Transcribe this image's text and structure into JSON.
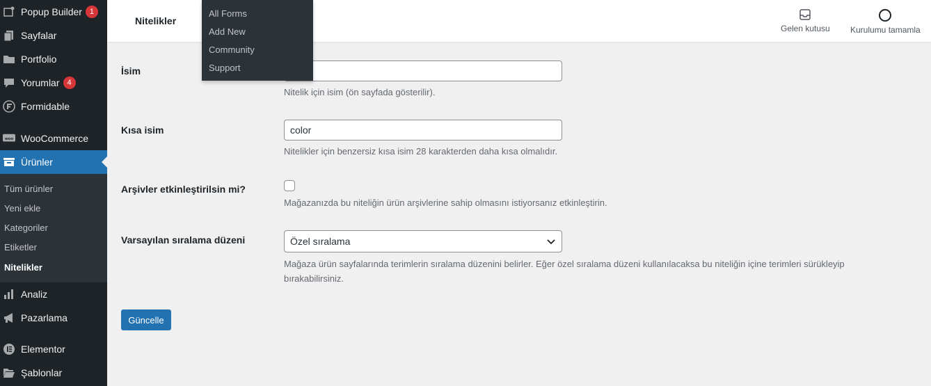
{
  "sidebar": {
    "items": [
      {
        "label": "Popup Builder",
        "badge": "1",
        "icon": "popup-icon"
      },
      {
        "label": "Sayfalar",
        "icon": "pages-icon"
      },
      {
        "label": "Portfolio",
        "icon": "folder-icon"
      },
      {
        "label": "Yorumlar",
        "badge": "4",
        "icon": "comment-icon"
      },
      {
        "label": "Formidable",
        "icon": "formidable-icon"
      },
      {
        "label": "WooCommerce",
        "icon": "woo-icon"
      },
      {
        "label": "Ürünler",
        "icon": "archive-icon"
      },
      {
        "label": "Analiz",
        "icon": "chart-icon"
      },
      {
        "label": "Pazarlama",
        "icon": "megaphone-icon"
      },
      {
        "label": "Elementor",
        "icon": "elementor-icon"
      },
      {
        "label": "Şablonlar",
        "icon": "folder-open-icon"
      }
    ],
    "submenu": [
      "Tüm ürünler",
      "Yeni ekle",
      "Kategoriler",
      "Etiketler",
      "Nitelikler"
    ]
  },
  "header": {
    "title": "Nitelikler",
    "inbox_label": "Gelen kutusu",
    "setup_label": "Kurulumu tamamla"
  },
  "flyout": [
    "All Forms",
    "Add New",
    "Community",
    "Support"
  ],
  "form": {
    "name_label": "İsim",
    "name_value": "",
    "name_desc": "Nitelik için isim (ön sayfada gösterilir).",
    "slug_label": "Kısa isim",
    "slug_value": "color",
    "slug_desc": "Nitelikler için benzersiz kısa isim 28 karakterden daha kısa olmalıdır.",
    "archive_label": "Arşivler etkinleştirilsin mi?",
    "archive_desc": "Mağazanızda bu niteliğin ürün arşivlerine sahip olmasını istiyorsanız etkinleştirin.",
    "order_label": "Varsayılan sıralama düzeni",
    "order_value": "Özel sıralama",
    "order_desc_1": "Mağaza ürün sayfalarında terimlerin sıralama düzenini belirler. Eğer özel sıralama düzeni kullanılacaksa bu niteliğin içine terimleri sürükleyip",
    "order_desc_2": "bırakabilirsiniz.",
    "submit_label": "Güncelle"
  }
}
